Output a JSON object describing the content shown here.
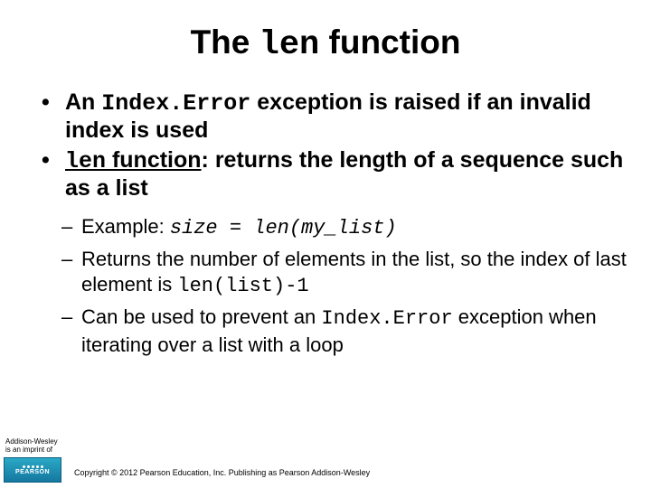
{
  "title": {
    "pre": "The ",
    "code": "len",
    "post": " function"
  },
  "bullets": [
    {
      "parts": [
        {
          "t": "An "
        },
        {
          "t": "Index.Error",
          "mono": true
        },
        {
          "t": " exception is raised if an  invalid index is used"
        }
      ]
    },
    {
      "parts": [
        {
          "t": "len",
          "mono": true,
          "ul": true
        },
        {
          "t": " function",
          "ul": true
        },
        {
          "t": ": returns the length of a sequence such as a list"
        }
      ]
    }
  ],
  "subbullets": [
    {
      "parts": [
        {
          "t": "Example: "
        },
        {
          "t": "size = len(my_list)",
          "mono": true,
          "ital": true
        }
      ]
    },
    {
      "parts": [
        {
          "t": "Returns the number of elements in the list, so the index of last element is "
        },
        {
          "t": "len(list)-1",
          "mono": true
        }
      ]
    },
    {
      "parts": [
        {
          "t": "Can be used to prevent an "
        },
        {
          "t": "Index.Error",
          "mono": true
        },
        {
          "t": " exception when iterating over a list with a loop"
        }
      ]
    }
  ],
  "footer": {
    "imprint_line1": "Addison-Wesley",
    "imprint_line2": "is an imprint of",
    "logo_text": "PEARSON",
    "copyright": "Copyright © 2012 Pearson Education, Inc. Publishing as Pearson Addison-Wesley"
  }
}
